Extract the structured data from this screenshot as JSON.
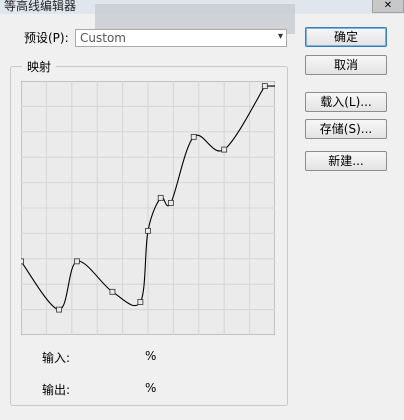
{
  "window": {
    "title": "等高线编辑器",
    "close_glyph": "✕"
  },
  "preset": {
    "label": "预设(P):",
    "value": "Custom"
  },
  "buttons": {
    "ok": "确定",
    "cancel": "取消",
    "load": "载入(L)...",
    "save": "存储(S)...",
    "new": "新建..."
  },
  "mapping": {
    "group_label": "映射",
    "input_label": "输入:",
    "input_unit": "%",
    "output_label": "输出:",
    "output_unit": "%"
  },
  "curve": {
    "grid_divisions": 10,
    "stroke_color": "#000000",
    "grid_color": "#d6d6d6",
    "background": "#ebebeb",
    "points": [
      {
        "x": 0,
        "y": 29
      },
      {
        "x": 15,
        "y": 10
      },
      {
        "x": 22,
        "y": 29
      },
      {
        "x": 36,
        "y": 17
      },
      {
        "x": 47,
        "y": 13
      },
      {
        "x": 50,
        "y": 41
      },
      {
        "x": 55,
        "y": 54
      },
      {
        "x": 59,
        "y": 52
      },
      {
        "x": 68,
        "y": 78
      },
      {
        "x": 80,
        "y": 73
      },
      {
        "x": 96,
        "y": 98
      }
    ]
  }
}
